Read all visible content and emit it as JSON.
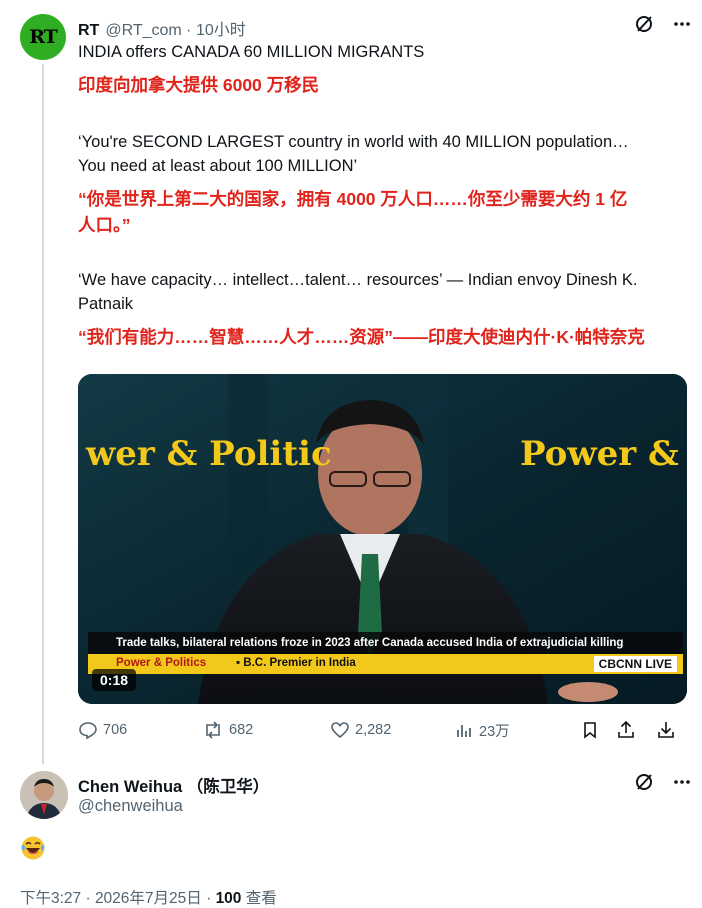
{
  "tweet": {
    "author_name": "RT",
    "author_handle": "@RT_com · 10小时",
    "avatar_text": "RT",
    "line1_en": "INDIA offers CANADA 60 MILLION MIGRANTS",
    "line1_cn": "印度向加拿大提供 6000 万移民",
    "quote1_en_a": "‘You're SECOND LARGEST country in world with 40 MILLION population…",
    "quote1_en_b": "You need at least about 100 MILLION’",
    "quote1_cn_a": "“你是世界上第二大的国家，拥有 4000 万人口……你至少需要大约 1 亿",
    "quote1_cn_b": "人口。”",
    "quote2_en_a": "‘We have capacity… intellect…talent… resources’ — Indian envoy Dinesh K.",
    "quote2_en_b": "Patnaik",
    "quote2_cn": "“我们有能力……智慧……人才……资源”——印度大使迪内什·K·帕特奈克"
  },
  "video": {
    "left_sign": "wer & Politic",
    "right_sign": "Power &",
    "ticker_top": "Trade talks, bilateral relations froze in 2023 after Canada accused India of extrajudicial killing",
    "ticker_show": "Power & Politics",
    "ticker_topic": "▪ B.C. Premier in India",
    "network": "CBCNN LIVE",
    "duration": "0:18"
  },
  "actions": {
    "replies": "706",
    "reposts": "682",
    "likes": "2,282",
    "views": "23万"
  },
  "reply": {
    "author_name": "Chen Weihua （陈卫华）",
    "author_handle": "@chenweihua",
    "emoji": "laughing-tears",
    "meta_time": "下午3:27 · 2026年7月25日 · ",
    "meta_views": "100",
    "meta_views_label": " 查看"
  },
  "colors": {
    "red_text": "#e0241b",
    "rt_green": "#2fae24",
    "muted": "#536471",
    "ticker_yellow": "#f2c81b"
  }
}
